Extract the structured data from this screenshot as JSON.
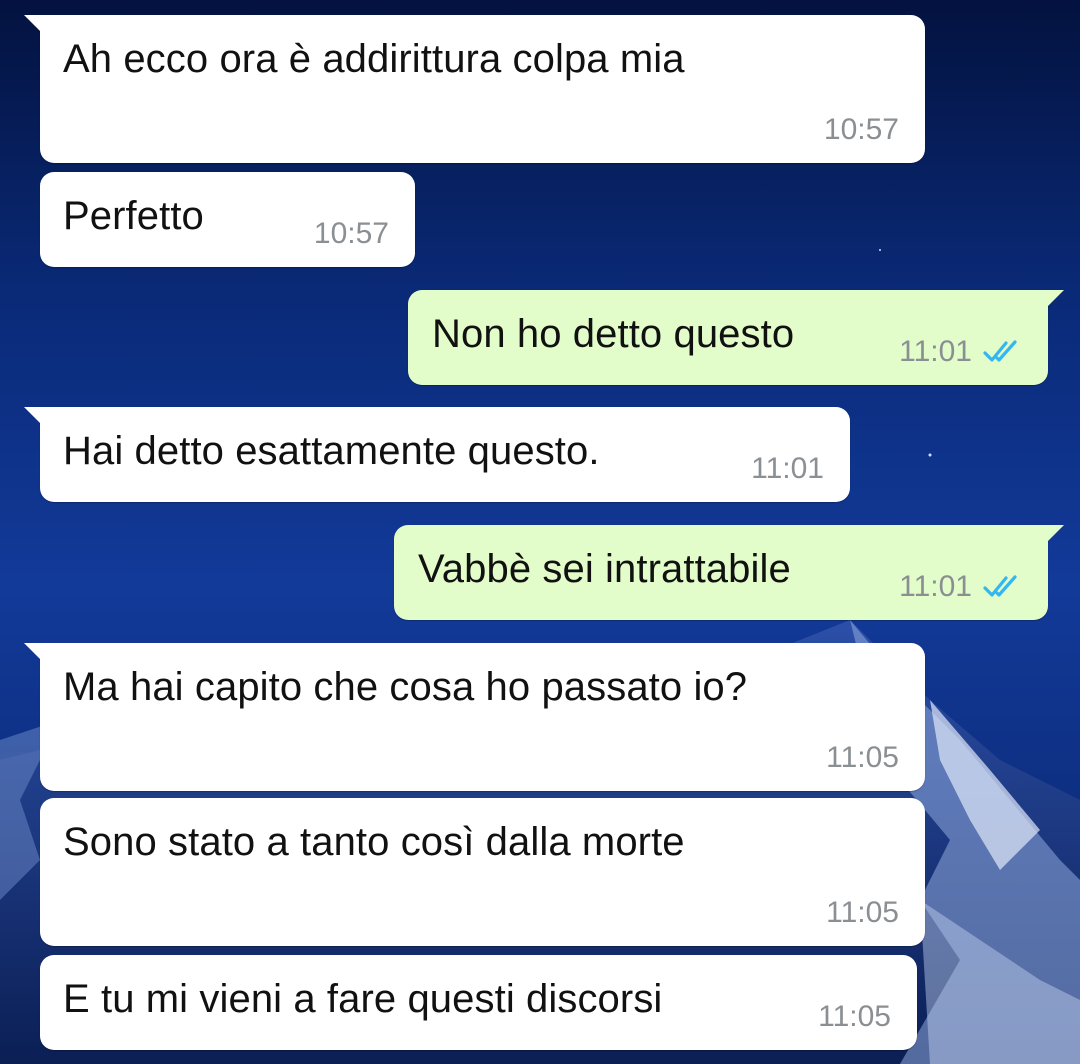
{
  "colors": {
    "incoming_bubble": "#ffffff",
    "outgoing_bubble": "#e2fdc9",
    "timestamp": "#8a8f93",
    "read_ticks": "#34b7f1"
  },
  "messages": [
    {
      "direction": "incoming",
      "text": "Ah ecco ora è addirittura colpa mia",
      "time": "10:57"
    },
    {
      "direction": "incoming",
      "text": "Perfetto",
      "time": "10:57"
    },
    {
      "direction": "outgoing",
      "text": "Non ho detto questo",
      "time": "11:01",
      "status_icon": "double-check-read-icon"
    },
    {
      "direction": "incoming",
      "text": "Hai detto esattamente questo.",
      "time": "11:01"
    },
    {
      "direction": "outgoing",
      "text": "Vabbè sei intrattabile",
      "time": "11:01",
      "status_icon": "double-check-read-icon"
    },
    {
      "direction": "incoming",
      "text": "Ma hai capito che cosa ho passato io?",
      "time": "11:05"
    },
    {
      "direction": "incoming",
      "text": "Sono stato a tanto così dalla morte",
      "time": "11:05"
    },
    {
      "direction": "incoming",
      "text": "E tu mi vieni a fare questi discorsi",
      "time": "11:05"
    }
  ]
}
